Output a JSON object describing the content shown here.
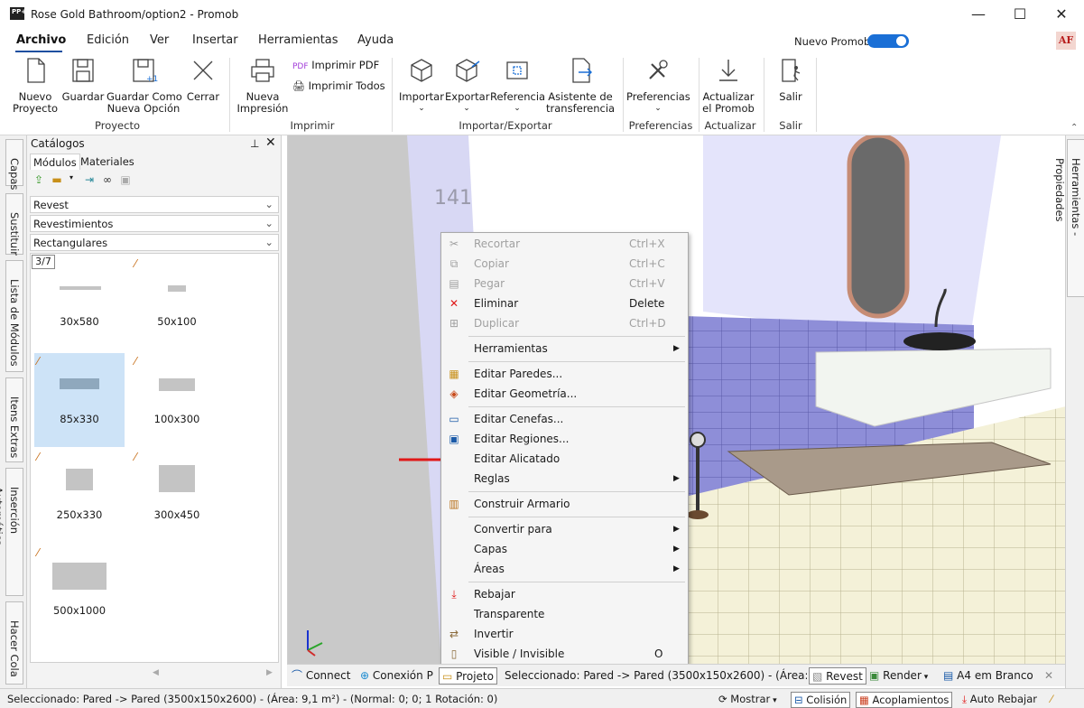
{
  "window": {
    "title": "Rose Gold Bathroom/option2 - Promob",
    "app_icon": "PP+",
    "controls": {
      "minimize": "—",
      "maximize": "☐",
      "close": "✕"
    }
  },
  "menu": {
    "items": [
      "Archivo",
      "Edición",
      "Ver",
      "Insertar",
      "Herramientas",
      "Ayuda"
    ],
    "nuevo_promob": "Nuevo Promob",
    "user_badge": "AF",
    "accent": "#1a6fd6"
  },
  "ribbon": {
    "buttons": {
      "nuevo": "Nuevo\nProyecto",
      "guardar": "Guardar",
      "guardar_como": "Guardar Como\nNueva Opción",
      "cerrar": "Cerrar",
      "nueva_impresion": "Nueva\nImpresión",
      "imprimir_pdf": "Imprimir PDF",
      "imprimir_todos": "Imprimir Todos",
      "importar": "Importar",
      "exportar": "Exportar",
      "referencia": "Referencia",
      "asistente": "Asistente de\ntransferencia",
      "preferencias": "Preferencias",
      "actualizar": "Actualizar\nel Promob",
      "salir": "Salir"
    },
    "groups": {
      "proyecto": "Proyecto",
      "imprimir": "Imprimir",
      "importar_exportar": "Importar/Exportar",
      "preferencias": "Preferencias",
      "actualizar": "Actualizar",
      "salir": "Salir"
    }
  },
  "side_tabs": [
    "Capas",
    "Sustituir",
    "Lista de Módulos",
    "Itens Extras",
    "Inserción Automática",
    "Hacer Cola"
  ],
  "right_tabs": [
    "Herramientas - Propiedades"
  ],
  "catalog": {
    "title": "Catálogos",
    "tabs": [
      "Módulos",
      "Materiales"
    ],
    "selects": [
      "Revest",
      "Revestimientos",
      "Rectangulares"
    ],
    "pager": "3/7",
    "items": [
      {
        "label": "30x580",
        "selected": false
      },
      {
        "label": "50x100",
        "selected": false
      },
      {
        "label": "85x330",
        "selected": true
      },
      {
        "label": "100x300",
        "selected": false
      },
      {
        "label": "250x330",
        "selected": false
      },
      {
        "label": "300x450",
        "selected": false
      },
      {
        "label": "500x1000",
        "selected": false
      }
    ]
  },
  "viewport": {
    "dimension_label": "141"
  },
  "context_menu": {
    "items": [
      {
        "label": "Recortar",
        "shortcut": "Ctrl+X",
        "disabled": true,
        "icon": "scissors-icon"
      },
      {
        "label": "Copiar",
        "shortcut": "Ctrl+C",
        "disabled": true,
        "icon": "copy-icon"
      },
      {
        "label": "Pegar",
        "shortcut": "Ctrl+V",
        "disabled": true,
        "icon": "paste-icon"
      },
      {
        "label": "Eliminar",
        "shortcut": "Delete",
        "disabled": false,
        "icon": "delete-icon"
      },
      {
        "label": "Duplicar",
        "shortcut": "Ctrl+D",
        "disabled": true,
        "icon": "duplicate-icon"
      },
      {
        "label": "Herramientas",
        "submenu": true
      },
      {
        "label": "Editar Paredes...",
        "icon": "walls-icon"
      },
      {
        "label": "Editar Geometría...",
        "icon": "geometry-icon"
      },
      {
        "label": "Editar Cenefas...",
        "icon": "cenefas-icon"
      },
      {
        "label": "Editar Regiones...",
        "icon": "regions-icon"
      },
      {
        "label": "Editar Alicatado",
        "icon": "tiles-icon"
      },
      {
        "label": "Reglas",
        "submenu": true
      },
      {
        "label": "Construir Armario",
        "icon": "wardrobe-icon"
      },
      {
        "label": "Convertir para",
        "submenu": true
      },
      {
        "label": "Capas",
        "submenu": true
      },
      {
        "label": "Áreas",
        "submenu": true
      },
      {
        "label": "Rebajar",
        "icon": "lower-icon"
      },
      {
        "label": "Transparente"
      },
      {
        "label": "Invertir",
        "icon": "invert-icon"
      },
      {
        "label": "Visible / Invisible",
        "shortcut": "O",
        "icon": "visible-icon"
      }
    ]
  },
  "bottom_tabs": {
    "connect": "Connect",
    "conexion": "Conexión P",
    "projeto": "Projeto",
    "selected_text": "Seleccionado: Pared -> Pared (3500x150x2600) - (Área: 9,...",
    "revest": "Revest",
    "render": "Render",
    "a4": "A4 em Branco"
  },
  "status": {
    "selection": "Seleccionado: Pared -> Pared (3500x150x2600) - (Área: 9,1 m²) - (Normal: 0; 0; 1 Rotación: 0)",
    "mostrar": "Mostrar",
    "colision": "Colisión",
    "acoplamientos": "Acoplamientos",
    "auto_rebajar": "Auto Rebajar"
  }
}
